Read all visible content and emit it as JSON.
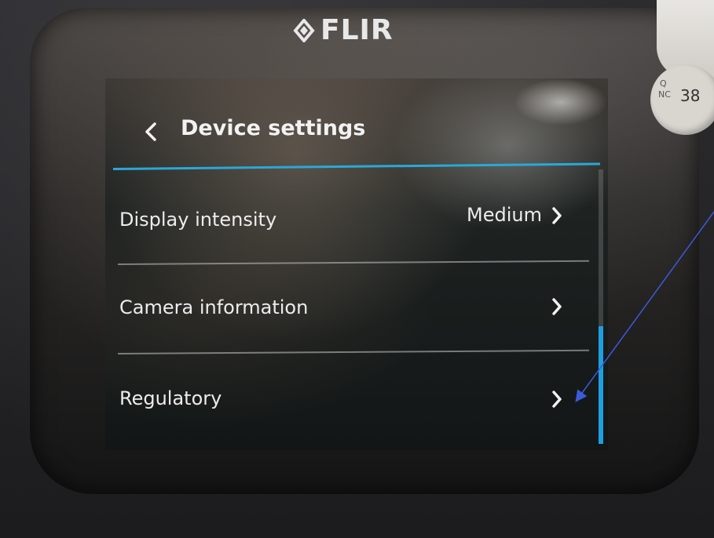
{
  "brand": {
    "logo_text": "FLIR"
  },
  "sticker": {
    "line1": "Q",
    "line2": "NC",
    "number": "38"
  },
  "header": {
    "title": "Device settings"
  },
  "settings": {
    "items": [
      {
        "label": "Display intensity",
        "value": "Medium"
      },
      {
        "label": "Camera information",
        "value": ""
      },
      {
        "label": "Regulatory",
        "value": ""
      }
    ]
  },
  "colors": {
    "accent": "#2aa8d8",
    "scroll_thumb": "#1e9fe0",
    "text": "#ececec",
    "annotation_arrow": "#3b5bdb"
  },
  "icons": {
    "back": "chevron-left-icon",
    "row_arrow": "chevron-right-icon",
    "logo_mark": "flir-diamond-icon"
  }
}
